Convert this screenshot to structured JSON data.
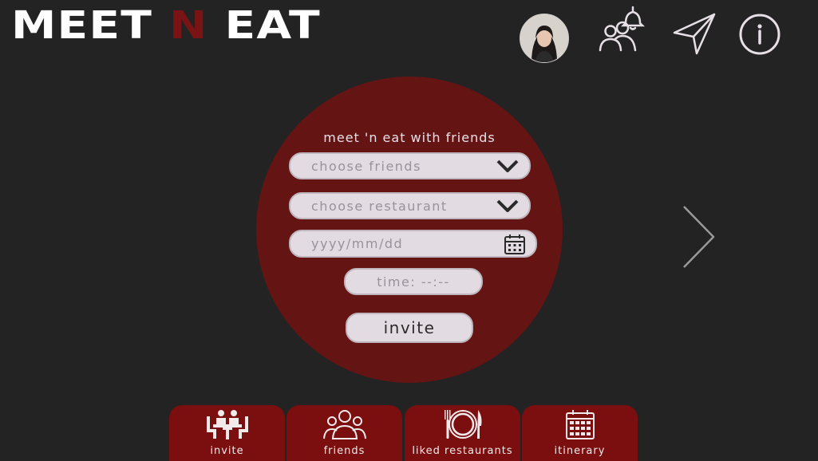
{
  "logo": {
    "part1": "MEET ",
    "part2": "N",
    "part3": " EAT"
  },
  "form": {
    "title": "meet 'n eat with friends",
    "friends_select": "choose friends",
    "restaurant_select": "choose restaurant",
    "date_field": "yyyy/mm/dd",
    "time_field": "time: --:--",
    "invite_button": "invite"
  },
  "bottom_nav": {
    "invite": "invite",
    "friends": "friends",
    "liked": "liked restaurants",
    "itinerary": "itinerary"
  },
  "colors": {
    "background": "#232323",
    "circle": "#651414",
    "nav_tab": "#7b0e0e",
    "logo_accent": "#7a1414",
    "field": "#e3dbe2"
  },
  "icons": [
    "avatar",
    "friends-bell-icon",
    "send-icon",
    "info-icon",
    "chevron-down-icon",
    "calendar-icon",
    "chevron-right-icon",
    "dining-icon",
    "people-icon",
    "plate-icon",
    "itinerary-calendar-icon"
  ]
}
